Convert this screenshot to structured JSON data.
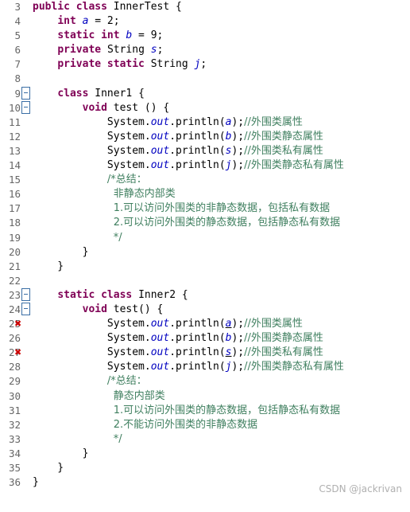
{
  "editor": {
    "watermark": "CSDN @jackrivan",
    "first_line_number": 3,
    "lines": [
      {
        "n": 3,
        "fold": false,
        "err": false,
        "segments": [
          {
            "t": "public class ",
            "c": "kw"
          },
          {
            "t": "InnerTest ",
            "c": "plain"
          },
          {
            "t": "{",
            "c": "plain"
          }
        ]
      },
      {
        "n": 4,
        "fold": false,
        "err": false,
        "segments": [
          {
            "t": "    ",
            "c": "plain"
          },
          {
            "t": "int ",
            "c": "kw"
          },
          {
            "t": "a",
            "c": "fld"
          },
          {
            "t": " = 2;",
            "c": "plain"
          }
        ]
      },
      {
        "n": 5,
        "fold": false,
        "err": false,
        "segments": [
          {
            "t": "    ",
            "c": "plain"
          },
          {
            "t": "static int ",
            "c": "kw"
          },
          {
            "t": "b",
            "c": "fld"
          },
          {
            "t": " = 9;",
            "c": "plain"
          }
        ]
      },
      {
        "n": 6,
        "fold": false,
        "err": false,
        "segments": [
          {
            "t": "    ",
            "c": "plain"
          },
          {
            "t": "private ",
            "c": "kw"
          },
          {
            "t": "String ",
            "c": "plain"
          },
          {
            "t": "s",
            "c": "fld"
          },
          {
            "t": ";",
            "c": "plain"
          }
        ]
      },
      {
        "n": 7,
        "fold": false,
        "err": false,
        "segments": [
          {
            "t": "    ",
            "c": "plain"
          },
          {
            "t": "private static ",
            "c": "kw"
          },
          {
            "t": "String ",
            "c": "plain"
          },
          {
            "t": "j",
            "c": "fld"
          },
          {
            "t": ";",
            "c": "plain"
          }
        ]
      },
      {
        "n": 8,
        "fold": false,
        "err": false,
        "segments": []
      },
      {
        "n": 9,
        "fold": true,
        "err": false,
        "segments": [
          {
            "t": "    ",
            "c": "plain"
          },
          {
            "t": "class ",
            "c": "kw"
          },
          {
            "t": "Inner1 {",
            "c": "plain"
          }
        ]
      },
      {
        "n": 10,
        "fold": true,
        "err": false,
        "segments": [
          {
            "t": "        ",
            "c": "plain"
          },
          {
            "t": "void ",
            "c": "kw"
          },
          {
            "t": "test () {",
            "c": "plain"
          }
        ]
      },
      {
        "n": 11,
        "fold": false,
        "err": false,
        "segments": [
          {
            "t": "            System.",
            "c": "plain"
          },
          {
            "t": "out",
            "c": "sfld"
          },
          {
            "t": ".println(",
            "c": "plain"
          },
          {
            "t": "a",
            "c": "fld"
          },
          {
            "t": ");",
            "c": "plain"
          },
          {
            "t": "//外围类属性",
            "c": "cmt-cn"
          }
        ]
      },
      {
        "n": 12,
        "fold": false,
        "err": false,
        "segments": [
          {
            "t": "            System.",
            "c": "plain"
          },
          {
            "t": "out",
            "c": "sfld"
          },
          {
            "t": ".println(",
            "c": "plain"
          },
          {
            "t": "b",
            "c": "fld"
          },
          {
            "t": ");",
            "c": "plain"
          },
          {
            "t": "//外围类静态属性",
            "c": "cmt-cn"
          }
        ]
      },
      {
        "n": 13,
        "fold": false,
        "err": false,
        "segments": [
          {
            "t": "            System.",
            "c": "plain"
          },
          {
            "t": "out",
            "c": "sfld"
          },
          {
            "t": ".println(",
            "c": "plain"
          },
          {
            "t": "s",
            "c": "fld"
          },
          {
            "t": ");",
            "c": "plain"
          },
          {
            "t": "//外围类私有属性",
            "c": "cmt-cn"
          }
        ]
      },
      {
        "n": 14,
        "fold": false,
        "err": false,
        "segments": [
          {
            "t": "            System.",
            "c": "plain"
          },
          {
            "t": "out",
            "c": "sfld"
          },
          {
            "t": ".println(",
            "c": "plain"
          },
          {
            "t": "j",
            "c": "fld"
          },
          {
            "t": ");",
            "c": "plain"
          },
          {
            "t": "//外围类静态私有属性",
            "c": "cmt-cn"
          }
        ]
      },
      {
        "n": 15,
        "fold": false,
        "err": false,
        "segments": [
          {
            "t": "            ",
            "c": "plain"
          },
          {
            "t": "/*总结：",
            "c": "cmt-cn"
          }
        ]
      },
      {
        "n": 16,
        "fold": false,
        "err": false,
        "segments": [
          {
            "t": "             ",
            "c": "plain"
          },
          {
            "t": "非静态内部类",
            "c": "cmt-cn"
          }
        ]
      },
      {
        "n": 17,
        "fold": false,
        "err": false,
        "segments": [
          {
            "t": "             ",
            "c": "plain"
          },
          {
            "t": "1.可以访问外围类的非静态数据，包括私有数据",
            "c": "cmt-cn"
          }
        ]
      },
      {
        "n": 18,
        "fold": false,
        "err": false,
        "segments": [
          {
            "t": "             ",
            "c": "plain"
          },
          {
            "t": "2.可以访问外围类的静态数据，包括静态私有数据",
            "c": "cmt-cn"
          }
        ]
      },
      {
        "n": 19,
        "fold": false,
        "err": false,
        "segments": [
          {
            "t": "             ",
            "c": "plain"
          },
          {
            "t": "*/",
            "c": "cmt-cn"
          }
        ]
      },
      {
        "n": 20,
        "fold": false,
        "err": false,
        "segments": [
          {
            "t": "        }",
            "c": "plain"
          }
        ]
      },
      {
        "n": 21,
        "fold": false,
        "err": false,
        "segments": [
          {
            "t": "    }",
            "c": "plain"
          }
        ]
      },
      {
        "n": 22,
        "fold": false,
        "err": false,
        "segments": []
      },
      {
        "n": 23,
        "fold": true,
        "err": false,
        "segments": [
          {
            "t": "    ",
            "c": "plain"
          },
          {
            "t": "static class ",
            "c": "kw"
          },
          {
            "t": "Inner2 {",
            "c": "plain"
          }
        ]
      },
      {
        "n": 24,
        "fold": true,
        "err": false,
        "segments": [
          {
            "t": "        ",
            "c": "plain"
          },
          {
            "t": "void ",
            "c": "kw"
          },
          {
            "t": "test() {",
            "c": "plain"
          }
        ]
      },
      {
        "n": 25,
        "fold": false,
        "err": true,
        "segments": [
          {
            "t": "            System.",
            "c": "plain"
          },
          {
            "t": "out",
            "c": "sfld"
          },
          {
            "t": ".println(",
            "c": "plain"
          },
          {
            "t": "a",
            "c": "err"
          },
          {
            "t": ");",
            "c": "plain"
          },
          {
            "t": "//外围类属性",
            "c": "cmt-cn"
          }
        ]
      },
      {
        "n": 26,
        "fold": false,
        "err": false,
        "segments": [
          {
            "t": "            System.",
            "c": "plain"
          },
          {
            "t": "out",
            "c": "sfld"
          },
          {
            "t": ".println(",
            "c": "plain"
          },
          {
            "t": "b",
            "c": "fld"
          },
          {
            "t": ");",
            "c": "plain"
          },
          {
            "t": "//外围类静态属性",
            "c": "cmt-cn"
          }
        ]
      },
      {
        "n": 27,
        "fold": false,
        "err": true,
        "segments": [
          {
            "t": "            System.",
            "c": "plain"
          },
          {
            "t": "out",
            "c": "sfld"
          },
          {
            "t": ".println(",
            "c": "plain"
          },
          {
            "t": "s",
            "c": "err"
          },
          {
            "t": ");",
            "c": "plain"
          },
          {
            "t": "//外围类私有属性",
            "c": "cmt-cn"
          }
        ]
      },
      {
        "n": 28,
        "fold": false,
        "err": false,
        "segments": [
          {
            "t": "            System.",
            "c": "plain"
          },
          {
            "t": "out",
            "c": "sfld"
          },
          {
            "t": ".println(",
            "c": "plain"
          },
          {
            "t": "j",
            "c": "fld"
          },
          {
            "t": ");",
            "c": "plain"
          },
          {
            "t": "//外围类静态私有属性",
            "c": "cmt-cn"
          }
        ]
      },
      {
        "n": 29,
        "fold": false,
        "err": false,
        "segments": [
          {
            "t": "            ",
            "c": "plain"
          },
          {
            "t": "/*总结：",
            "c": "cmt-cn"
          }
        ]
      },
      {
        "n": 30,
        "fold": false,
        "err": false,
        "segments": [
          {
            "t": "             ",
            "c": "plain"
          },
          {
            "t": "静态内部类",
            "c": "cmt-cn"
          }
        ]
      },
      {
        "n": 31,
        "fold": false,
        "err": false,
        "segments": [
          {
            "t": "             ",
            "c": "plain"
          },
          {
            "t": "1.可以访问外围类的静态数据，包括静态私有数据",
            "c": "cmt-cn"
          }
        ]
      },
      {
        "n": 32,
        "fold": false,
        "err": false,
        "segments": [
          {
            "t": "             ",
            "c": "plain"
          },
          {
            "t": "2.不能访问外围类的非静态数据",
            "c": "cmt-cn"
          }
        ]
      },
      {
        "n": 33,
        "fold": false,
        "err": false,
        "segments": [
          {
            "t": "             ",
            "c": "plain"
          },
          {
            "t": "*/",
            "c": "cmt-cn"
          }
        ]
      },
      {
        "n": 34,
        "fold": false,
        "err": false,
        "segments": [
          {
            "t": "        }",
            "c": "plain"
          }
        ]
      },
      {
        "n": 35,
        "fold": false,
        "err": false,
        "segments": [
          {
            "t": "    }",
            "c": "plain"
          }
        ]
      },
      {
        "n": 36,
        "fold": false,
        "err": false,
        "segments": [
          {
            "t": "}",
            "c": "plain"
          }
        ]
      }
    ],
    "colors": {
      "keyword": "#7f0055",
      "field": "#0000c0",
      "comment": "#3f7f5f",
      "error": "#cc0000",
      "gutter_text": "#666666",
      "fold_marker": "#3a6ea5",
      "background": "#ffffff"
    }
  }
}
